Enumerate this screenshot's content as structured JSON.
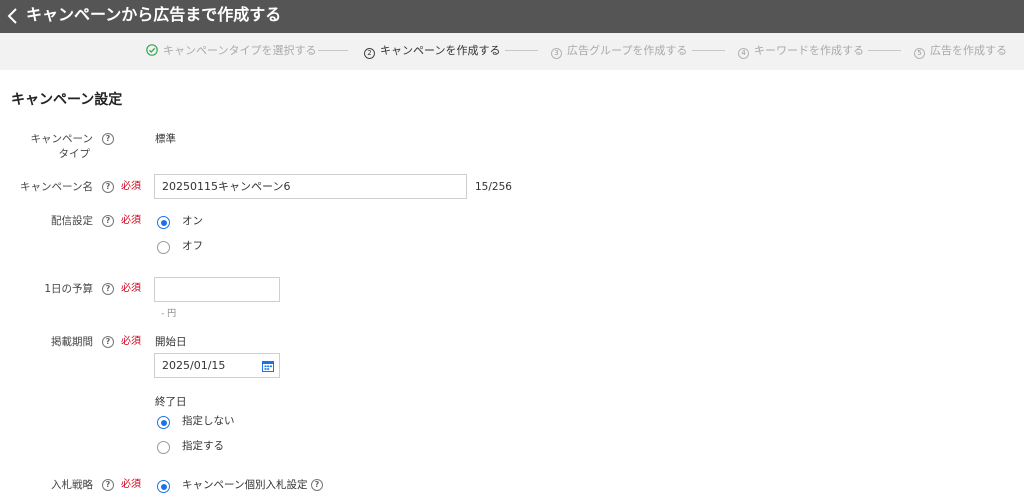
{
  "header": {
    "title": "キャンペーンから広告まで作成する"
  },
  "steps": [
    {
      "num": "✓",
      "label": "キャンペーンタイプを選択する"
    },
    {
      "num": "2",
      "label": "キャンペーンを作成する"
    },
    {
      "num": "3",
      "label": "広告グループを作成する"
    },
    {
      "num": "4",
      "label": "キーワードを作成する"
    },
    {
      "num": "5",
      "label": "広告を作成する"
    }
  ],
  "section": {
    "title": "キャンペーン設定"
  },
  "help_glyph": "?",
  "required_text": "必須",
  "form": {
    "campaign_type": {
      "label_line1": "キャンペーン",
      "label_line2": "タイプ",
      "value": "標準"
    },
    "campaign_name": {
      "label": "キャンペーン名",
      "value": "20250115キャンペーン6",
      "counter": "15/256"
    },
    "delivery": {
      "label": "配信設定",
      "options": [
        "オン",
        "オフ"
      ],
      "selected": "オン"
    },
    "daily_budget": {
      "label": "1日の予算",
      "value": "",
      "hint": "- 円"
    },
    "period": {
      "label": "掲載期間",
      "start_label": "開始日",
      "start_value": "2025/01/15",
      "end_label": "終了日",
      "end_options": [
        "指定しない",
        "指定する"
      ],
      "end_selected": "指定しない"
    },
    "bidding": {
      "label": "入札戦略",
      "option": "キャンペーン個別入札設定"
    }
  },
  "colors": {
    "header_bg": "#555555",
    "steps_bg": "#f2f2f2",
    "accent": "#1a73e8",
    "required": "#d0021b",
    "done": "#3aa757"
  }
}
